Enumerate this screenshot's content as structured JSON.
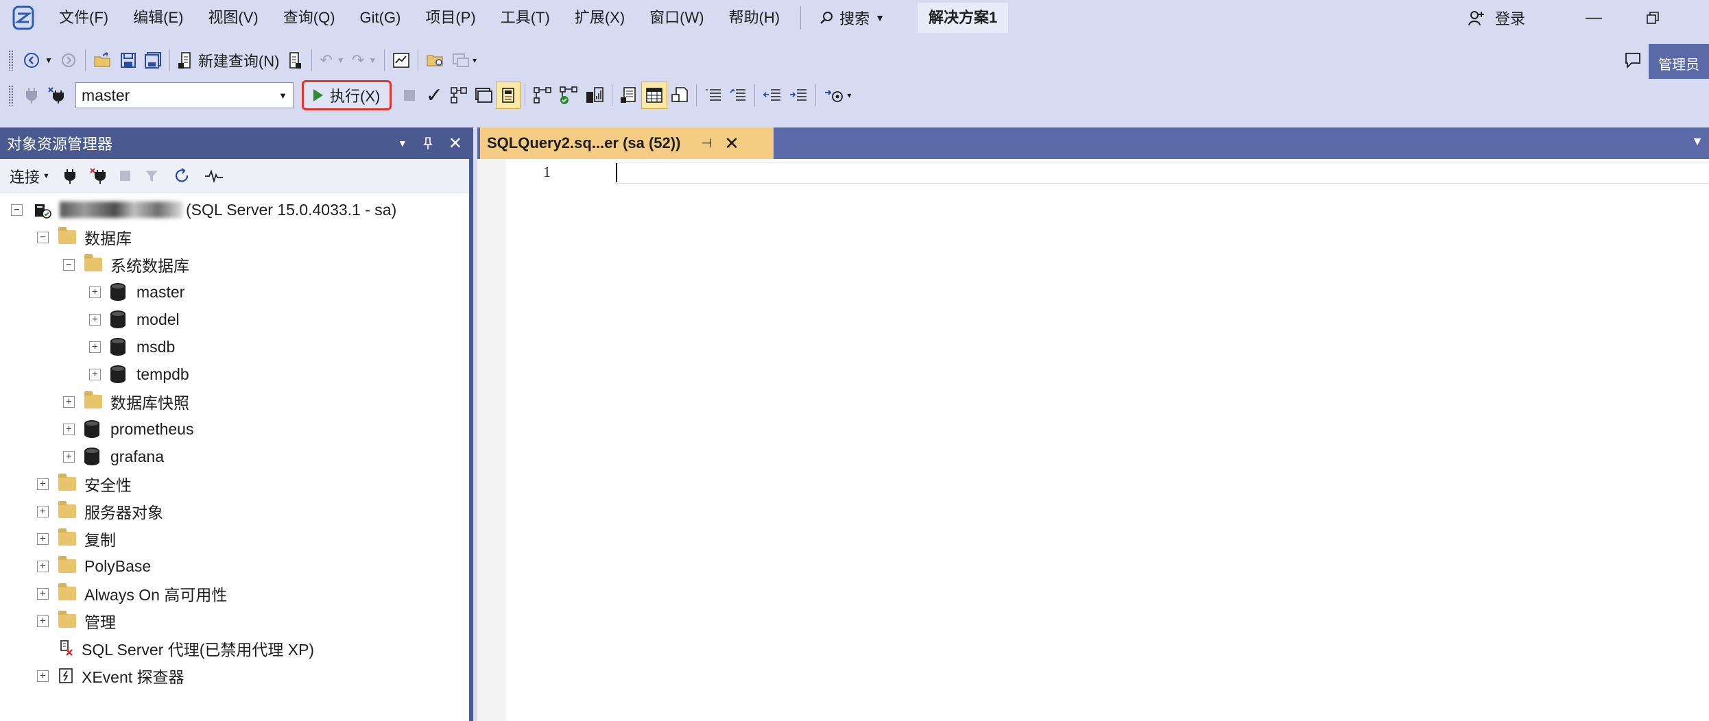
{
  "menu": {
    "items": [
      "文件(F)",
      "编辑(E)",
      "视图(V)",
      "查询(Q)",
      "Git(G)",
      "项目(P)",
      "工具(T)",
      "扩展(X)",
      "窗口(W)",
      "帮助(H)"
    ],
    "search_label": "搜索",
    "solution": "解决方案1",
    "login": "登录",
    "admin": "管理员"
  },
  "toolbar": {
    "new_query": "新建查询(N)",
    "database": "master",
    "execute": "执行(X)"
  },
  "explorer": {
    "title": "对象资源管理器",
    "connect": "连接",
    "server_suffix": "(SQL Server 15.0.4033.1 - sa)",
    "nodes": {
      "databases": "数据库",
      "system_databases": "系统数据库",
      "master": "master",
      "model": "model",
      "msdb": "msdb",
      "tempdb": "tempdb",
      "snapshots": "数据库快照",
      "prometheus": "prometheus",
      "grafana": "grafana",
      "security": "安全性",
      "server_objects": "服务器对象",
      "replication": "复制",
      "polybase": "PolyBase",
      "always_on": "Always On 高可用性",
      "management": "管理",
      "agent": "SQL Server 代理(已禁用代理 XP)",
      "xevent": "XEvent 探查器"
    }
  },
  "editor": {
    "tab_title": "SQLQuery2.sq...er (sa (52))",
    "line_number": "1"
  },
  "colors": {
    "chrome": "#d6dbf2",
    "panel_header": "#4a5a90",
    "active_tab": "#f5cc84",
    "execute_highlight": "#e0332b"
  }
}
